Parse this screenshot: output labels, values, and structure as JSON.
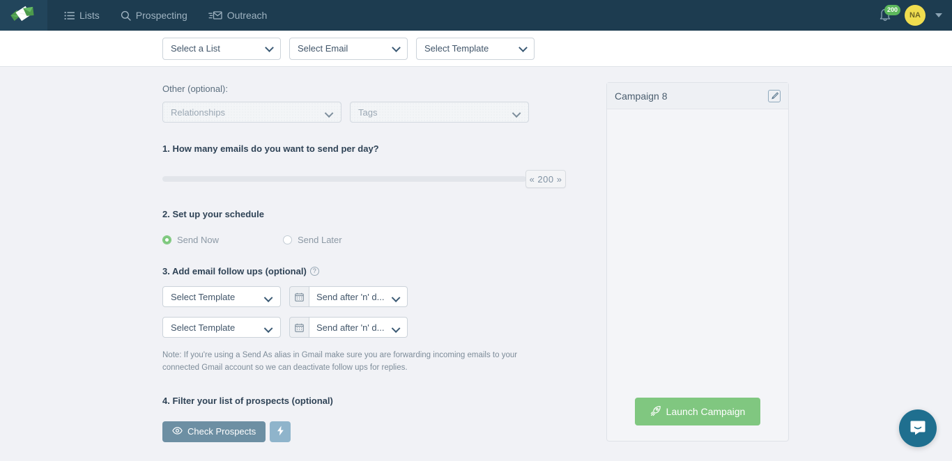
{
  "nav": {
    "logo_icon": "envelopes-logo-icon",
    "items": [
      {
        "label": "Lists",
        "icon": "list-icon"
      },
      {
        "label": "Prospecting",
        "icon": "search-icon"
      },
      {
        "label": "Outreach",
        "icon": "send-mail-icon"
      }
    ],
    "notifications": {
      "icon": "bell-icon",
      "count": "200"
    },
    "avatar": {
      "initials": "NA"
    },
    "account_caret_icon": "chevron-down-icon"
  },
  "subbar": {
    "list_select": "Select a List",
    "email_select": "Select Email",
    "template_select": "Select Template"
  },
  "form": {
    "other_label": "Other (optional):",
    "relationships_select": "Relationships",
    "tags_select": "Tags",
    "q1_title": "1. How many emails do you want to send per day?",
    "slider_value": "« 200 »",
    "q2_title": "2. Set up your schedule",
    "send_now_label": "Send Now",
    "send_later_label": "Send Later",
    "q3_title": "3. Add email follow ups (optional)",
    "q3_help_icon": "question-mark-icon",
    "followups": [
      {
        "template": "Select Template",
        "calendar_icon": "calendar-icon",
        "when": "Send after 'n' d..."
      },
      {
        "template": "Select Template",
        "calendar_icon": "calendar-icon",
        "when": "Send after 'n' d..."
      }
    ],
    "note": "Note: If you're using a Send As alias in Gmail make sure you are forwarding incoming emails to your connected Gmail account so we can deactivate follow ups for replies.",
    "q4_title": "4. Filter your list of prospects (optional)",
    "check_prospects_label": "Check Prospects",
    "check_prospects_icon": "eye-icon",
    "bolt_button_icon": "lightning-bolt-icon"
  },
  "campaign": {
    "title": "Campaign 8",
    "edit_icon": "edit-pencil-icon",
    "launch_label": "Launch Campaign",
    "launch_icon": "rocket-icon"
  },
  "chat": {
    "icon": "intercom-chat-icon"
  },
  "colors": {
    "navbar": "#1d3c50",
    "accent_green": "#80c780",
    "badge_green": "#5cb85c",
    "avatar_yellow": "#f0dd4f",
    "slate_button": "#6d8fa3",
    "page_bg": "#f1f2f6",
    "intercom_blue": "#1f6f8f"
  }
}
